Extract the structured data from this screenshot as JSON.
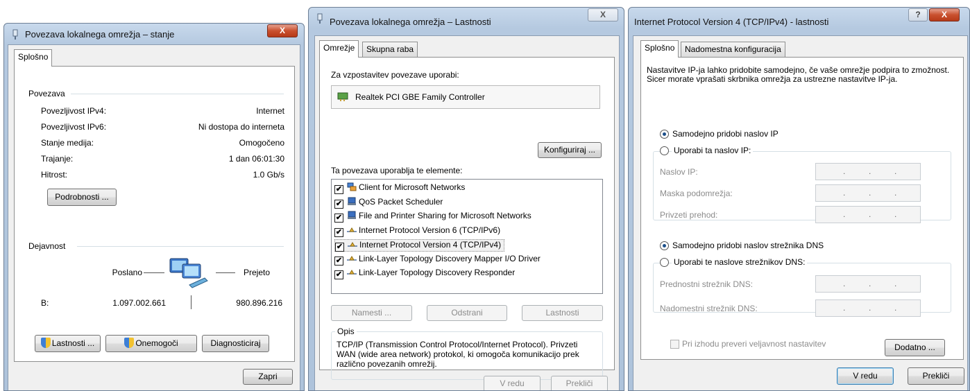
{
  "status_dialog": {
    "title": "Povezava lokalnega omrežja – stanje",
    "close_label": "X",
    "tab": "Splošno",
    "connection_header": "Povezava",
    "rows": [
      {
        "label": "Povezljivost IPv4:",
        "value": "Internet"
      },
      {
        "label": "Povezljivost IPv6:",
        "value": "Ni dostopa do interneta"
      },
      {
        "label": "Stanje medija:",
        "value": "Omogočeno"
      },
      {
        "label": "Trajanje:",
        "value": "1 dan 06:01:30"
      },
      {
        "label": "Hitrost:",
        "value": "1.0 Gb/s"
      }
    ],
    "details_button": "Podrobnosti ...",
    "activity_header": "Dejavnost",
    "sent_label": "Poslano",
    "received_label": "Prejeto",
    "bytes_label": "B:",
    "bytes_sent": "1.097.002.661",
    "bytes_received": "980.896.216",
    "properties_button": "Lastnosti ...",
    "disable_button": "Onemogoči",
    "diagnose_button": "Diagnosticiraj",
    "close_button": "Zapri"
  },
  "properties_dialog": {
    "title": "Povezava lokalnega omrežja – Lastnosti",
    "close_label": "X",
    "tabs": [
      "Omrežje",
      "Skupna raba"
    ],
    "connect_using_label": "Za vzpostavitev povezave uporabi:",
    "adapter": "Realtek PCI GBE Family Controller",
    "configure_button": "Konfiguriraj ...",
    "items_label": "Ta povezava uporablja te elemente:",
    "items": [
      {
        "label": "Client for Microsoft Networks",
        "checked": true,
        "icon": "network-client-icon"
      },
      {
        "label": "QoS Packet Scheduler",
        "checked": true,
        "icon": "service-icon"
      },
      {
        "label": "File and Printer Sharing for Microsoft Networks",
        "checked": true,
        "icon": "service-icon"
      },
      {
        "label": "Internet Protocol Version 6 (TCP/IPv6)",
        "checked": true,
        "icon": "protocol-icon"
      },
      {
        "label": "Internet Protocol Version 4 (TCP/IPv4)",
        "checked": true,
        "icon": "protocol-icon"
      },
      {
        "label": "Link-Layer Topology Discovery Mapper I/O Driver",
        "checked": true,
        "icon": "protocol-icon"
      },
      {
        "label": "Link-Layer Topology Discovery Responder",
        "checked": true,
        "icon": "protocol-icon"
      }
    ],
    "install_button": "Namesti ...",
    "uninstall_button": "Odstrani",
    "properties_button": "Lastnosti",
    "description_header": "Opis",
    "description": "TCP/IP (Transmission Control Protocol/Internet Protocol). Privzeti WAN (wide area network) protokol, ki omogoča komunikacijo prek različno povezanih omrežij.",
    "ok_button": "V redu",
    "cancel_button": "Prekliči"
  },
  "ipv4_dialog": {
    "title": "Internet Protocol Version 4 (TCP/IPv4) - lastnosti",
    "help_label": "?",
    "close_label": "X",
    "tabs": [
      "Splošno",
      "Nadomestna konfiguracija"
    ],
    "intro": "Nastavitve IP-ja lahko pridobite samodejno, če vaše omrežje podpira to zmožnost. Sicer morate vprašati skrbnika omrežja za ustrezne nastavitve IP-ja.",
    "auto_ip": "Samodejno pridobi naslov IP",
    "manual_ip": "Uporabi ta naslov IP:",
    "ip_address_label": "Naslov IP:",
    "subnet_label": "Maska podomrežja:",
    "gateway_label": "Privzeti prehod:",
    "auto_dns": "Samodejno pridobi naslov strežnika DNS",
    "manual_dns": "Uporabi te naslove strežnikov DNS:",
    "preferred_dns_label": "Prednostni strežnik DNS:",
    "alternate_dns_label": "Nadomestni strežnik DNS:",
    "ip_dots": ".",
    "validate_label": "Pri izhodu preveri veljavnost nastavitev",
    "advanced_button": "Dodatno ...",
    "ok_button": "V redu",
    "cancel_button": "Prekliči"
  }
}
